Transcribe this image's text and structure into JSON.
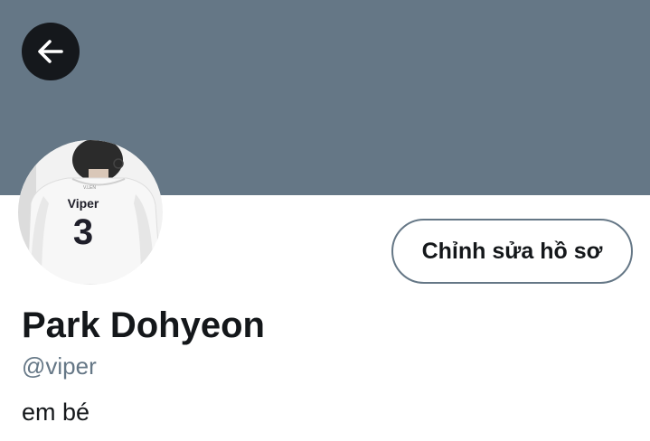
{
  "colors": {
    "banner": "#657786",
    "back_button_bg": "#15181c",
    "text_primary": "#14171a",
    "text_secondary": "#657786",
    "button_border": "#657786"
  },
  "header": {
    "back_icon": "arrow-left-icon"
  },
  "profile": {
    "avatar": {
      "jersey_name": "Viper",
      "jersey_number": "3"
    },
    "edit_button_label": "Chỉnh sửa hồ sơ",
    "display_name": "Park Dohyeon",
    "handle": "@viper",
    "bio": "em bé"
  }
}
